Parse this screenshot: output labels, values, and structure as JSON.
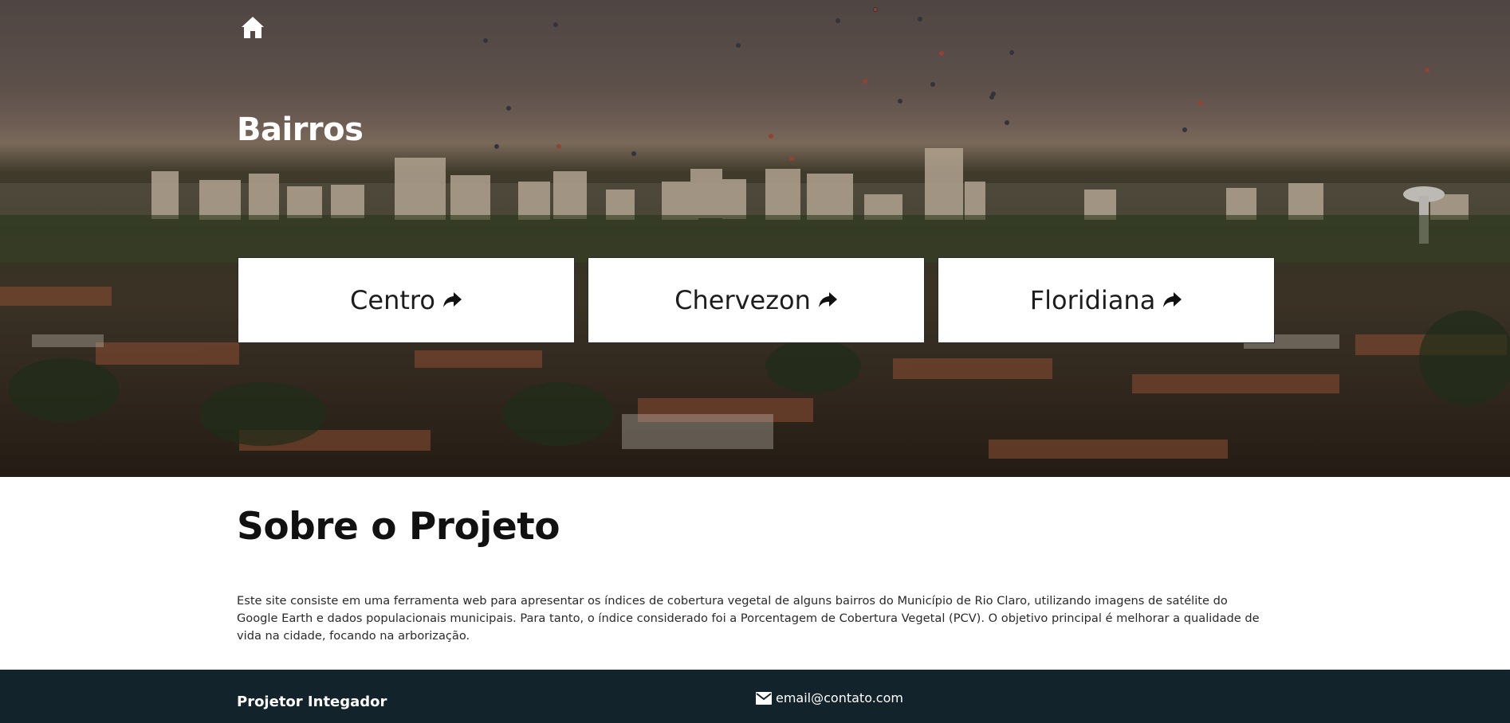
{
  "hero": {
    "title": "Bairros",
    "home_icon": "home-icon",
    "cards": [
      {
        "label": "Centro",
        "icon": "share-arrow-icon"
      },
      {
        "label": "Chervezon",
        "icon": "share-arrow-icon"
      },
      {
        "label": "Floridiana",
        "icon": "share-arrow-icon"
      }
    ]
  },
  "about": {
    "title": "Sobre o Projeto",
    "text": "Este site consiste em uma ferramenta web para apresentar os índices de cobertura vegetal de alguns bairros do Município de Rio Claro, utilizando imagens de satélite do Google Earth e dados populacionais municipais. Para tanto, o índice considerado foi a Porcentagem de Cobertura Vegetal (PCV). O objetivo principal é melhorar a qualidade de vida na cidade, focando na arborização."
  },
  "footer": {
    "title": "Projetor Integador",
    "email": "email@contato.com",
    "email_icon": "mail-icon"
  },
  "colors": {
    "footer_bg": "#13232b",
    "card_bg": "#ffffff",
    "hero_text": "#ffffff"
  }
}
